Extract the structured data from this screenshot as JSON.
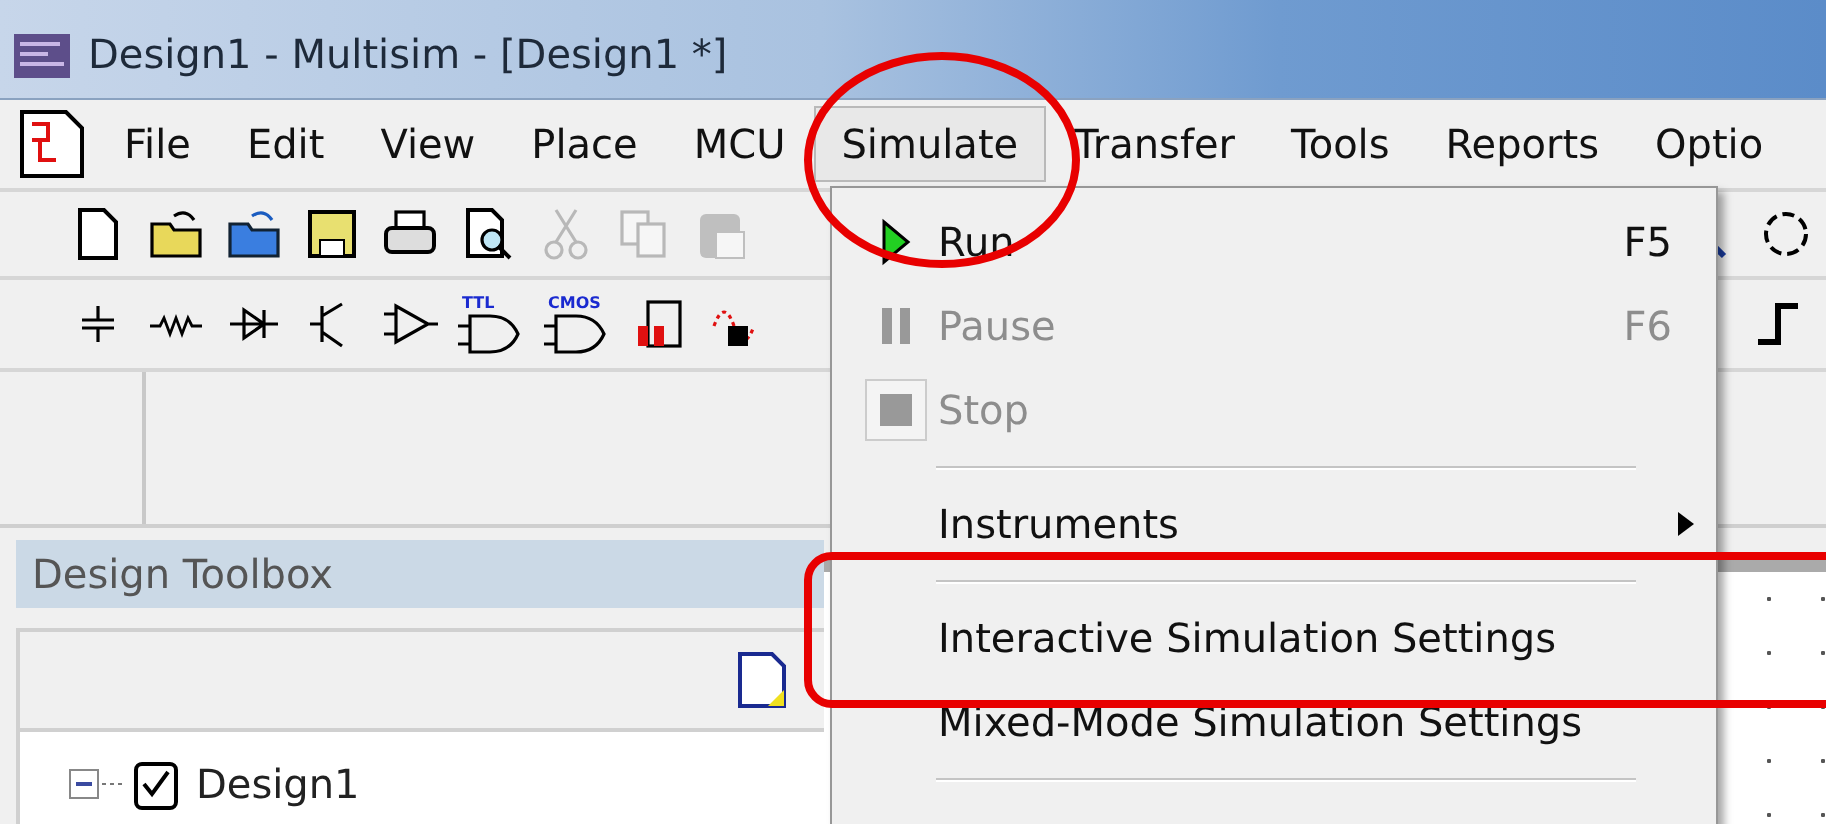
{
  "window": {
    "title": "Design1 - Multisim - [Design1 *]"
  },
  "menu_bar": [
    {
      "label": "File",
      "selected": false
    },
    {
      "label": "Edit",
      "selected": false
    },
    {
      "label": "View",
      "selected": false
    },
    {
      "label": "Place",
      "selected": false
    },
    {
      "label": "MCU",
      "selected": false
    },
    {
      "label": "Simulate",
      "selected": true
    },
    {
      "label": "Transfer",
      "selected": false
    },
    {
      "label": "Tools",
      "selected": false
    },
    {
      "label": "Reports",
      "selected": false
    },
    {
      "label": "Optio",
      "selected": false
    }
  ],
  "toolbar": [
    {
      "kind": "new",
      "disabled": false
    },
    {
      "kind": "open",
      "disabled": false
    },
    {
      "kind": "open-sample",
      "disabled": false
    },
    {
      "kind": "save",
      "disabled": false
    },
    {
      "kind": "print",
      "disabled": false
    },
    {
      "kind": "preview",
      "disabled": false
    },
    {
      "kind": "cut",
      "disabled": true
    },
    {
      "kind": "copy",
      "disabled": true
    },
    {
      "kind": "paste",
      "disabled": true
    }
  ],
  "toolbar_right": [
    {
      "kind": "zoom",
      "disabled": false
    },
    {
      "kind": "zoom-area",
      "disabled": false
    }
  ],
  "components_toolbar": [
    {
      "kind": "ground"
    },
    {
      "kind": "resistor"
    },
    {
      "kind": "diode"
    },
    {
      "kind": "transistor"
    },
    {
      "kind": "analog"
    },
    {
      "kind": "gate",
      "label": "TTL"
    },
    {
      "kind": "gate",
      "label": "CMOS"
    },
    {
      "kind": "digital"
    },
    {
      "kind": "mixed"
    }
  ],
  "components_toolbar_right": [
    {
      "kind": "step"
    }
  ],
  "design_toolbox": {
    "title": "Design Toolbox",
    "tree": [
      {
        "label": "Design1",
        "expanded": true
      }
    ]
  },
  "simulate_menu": [
    {
      "kind": "command",
      "label": "Run",
      "shortcut": "F5",
      "disabled": false
    },
    {
      "kind": "command",
      "label": "Pause",
      "shortcut": "F6",
      "disabled": true
    },
    {
      "kind": "command",
      "label": "Stop",
      "disabled": true
    },
    {
      "kind": "separator"
    },
    {
      "kind": "submenu",
      "label": "Instruments",
      "disabled": false
    },
    {
      "kind": "separator"
    },
    {
      "kind": "command",
      "label": "Interactive Simulation Settings",
      "disabled": false
    },
    {
      "kind": "command",
      "label": "Mixed-Mode Simulation Settings",
      "disabled": false
    },
    {
      "kind": "separator"
    }
  ],
  "annotations": [
    {
      "kind": "ellipse"
    },
    {
      "kind": "rect"
    }
  ]
}
